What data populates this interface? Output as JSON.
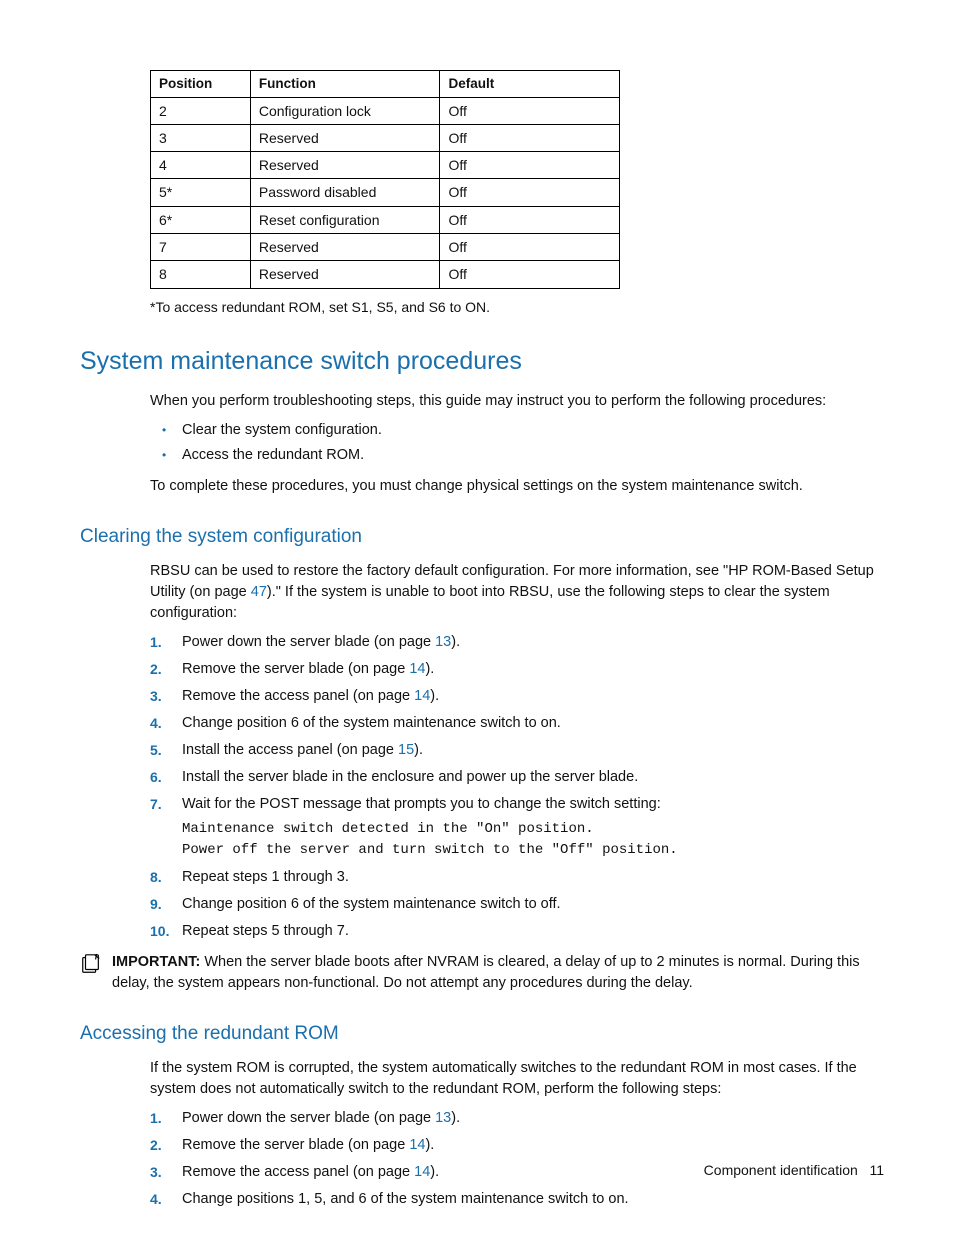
{
  "table": {
    "headers": {
      "c1": "Position",
      "c2": "Function",
      "c3": "Default"
    },
    "rows": [
      {
        "c1": "2",
        "c2": "Configuration lock",
        "c3": "Off"
      },
      {
        "c1": "3",
        "c2": "Reserved",
        "c3": "Off"
      },
      {
        "c1": "4",
        "c2": "Reserved",
        "c3": "Off"
      },
      {
        "c1": "5*",
        "c2": "Password disabled",
        "c3": "Off"
      },
      {
        "c1": "6*",
        "c2": "Reset configuration",
        "c3": "Off"
      },
      {
        "c1": "7",
        "c2": "Reserved",
        "c3": "Off"
      },
      {
        "c1": "8",
        "c2": "Reserved",
        "c3": "Off"
      }
    ],
    "note": "*To access redundant ROM, set S1, S5, and S6 to ON."
  },
  "h2_1": "System maintenance switch procedures",
  "s1": {
    "intro": "When you perform troubleshooting steps, this guide may instruct you to perform the following procedures:",
    "b1": "Clear the system configuration.",
    "b2": "Access the redundant ROM.",
    "outro": "To complete these procedures, you must change physical settings on the system maintenance switch."
  },
  "h3_1": "Clearing the system configuration",
  "s2": {
    "intro_a": "RBSU can be used to restore the factory default configuration. For more information, see \"HP ROM-Based Setup Utility (on page ",
    "intro_link": "47",
    "intro_b": ").\" If the system is unable to boot into RBSU, use the following steps to clear the system configuration:",
    "steps": {
      "l1a": "Power down the server blade (on page ",
      "l1b": "13",
      "l1c": ").",
      "l2a": "Remove the server blade (on page ",
      "l2b": "14",
      "l2c": ").",
      "l3a": "Remove the access panel (on page ",
      "l3b": "14",
      "l3c": ").",
      "l4": "Change position 6 of the system maintenance switch to on.",
      "l5a": "Install the access panel (on page ",
      "l5b": "15",
      "l5c": ").",
      "l6": "Install the server blade in the enclosure and power up the server blade.",
      "l7": "Wait for the POST message that prompts you to change the switch setting:",
      "l7code1": "Maintenance switch detected in the \"On\" position.",
      "l7code2": "Power off the server and turn switch to the \"Off\" position.",
      "l8": "Repeat steps 1 through 3.",
      "l9": "Change position 6 of the system maintenance switch to off.",
      "l10": "Repeat steps 5 through 7."
    }
  },
  "important": {
    "label": "IMPORTANT:",
    "text": "  When the server blade boots after NVRAM is cleared, a delay of up to 2 minutes is normal. During this delay, the system appears non-functional. Do not attempt any procedures during the delay."
  },
  "h3_2": "Accessing the redundant ROM",
  "s3": {
    "intro": "If the system ROM is corrupted, the system automatically switches to the redundant ROM in most cases. If the system does not automatically switch to the redundant ROM, perform the following steps:",
    "steps": {
      "l1a": "Power down the server blade (on page ",
      "l1b": "13",
      "l1c": ").",
      "l2a": "Remove the server blade (on page ",
      "l2b": "14",
      "l2c": ").",
      "l3a": "Remove the access panel (on page ",
      "l3b": "14",
      "l3c": ").",
      "l4": "Change positions 1, 5, and 6 of the system maintenance switch to on."
    }
  },
  "footer": {
    "section": "Component identification",
    "page": "11"
  }
}
